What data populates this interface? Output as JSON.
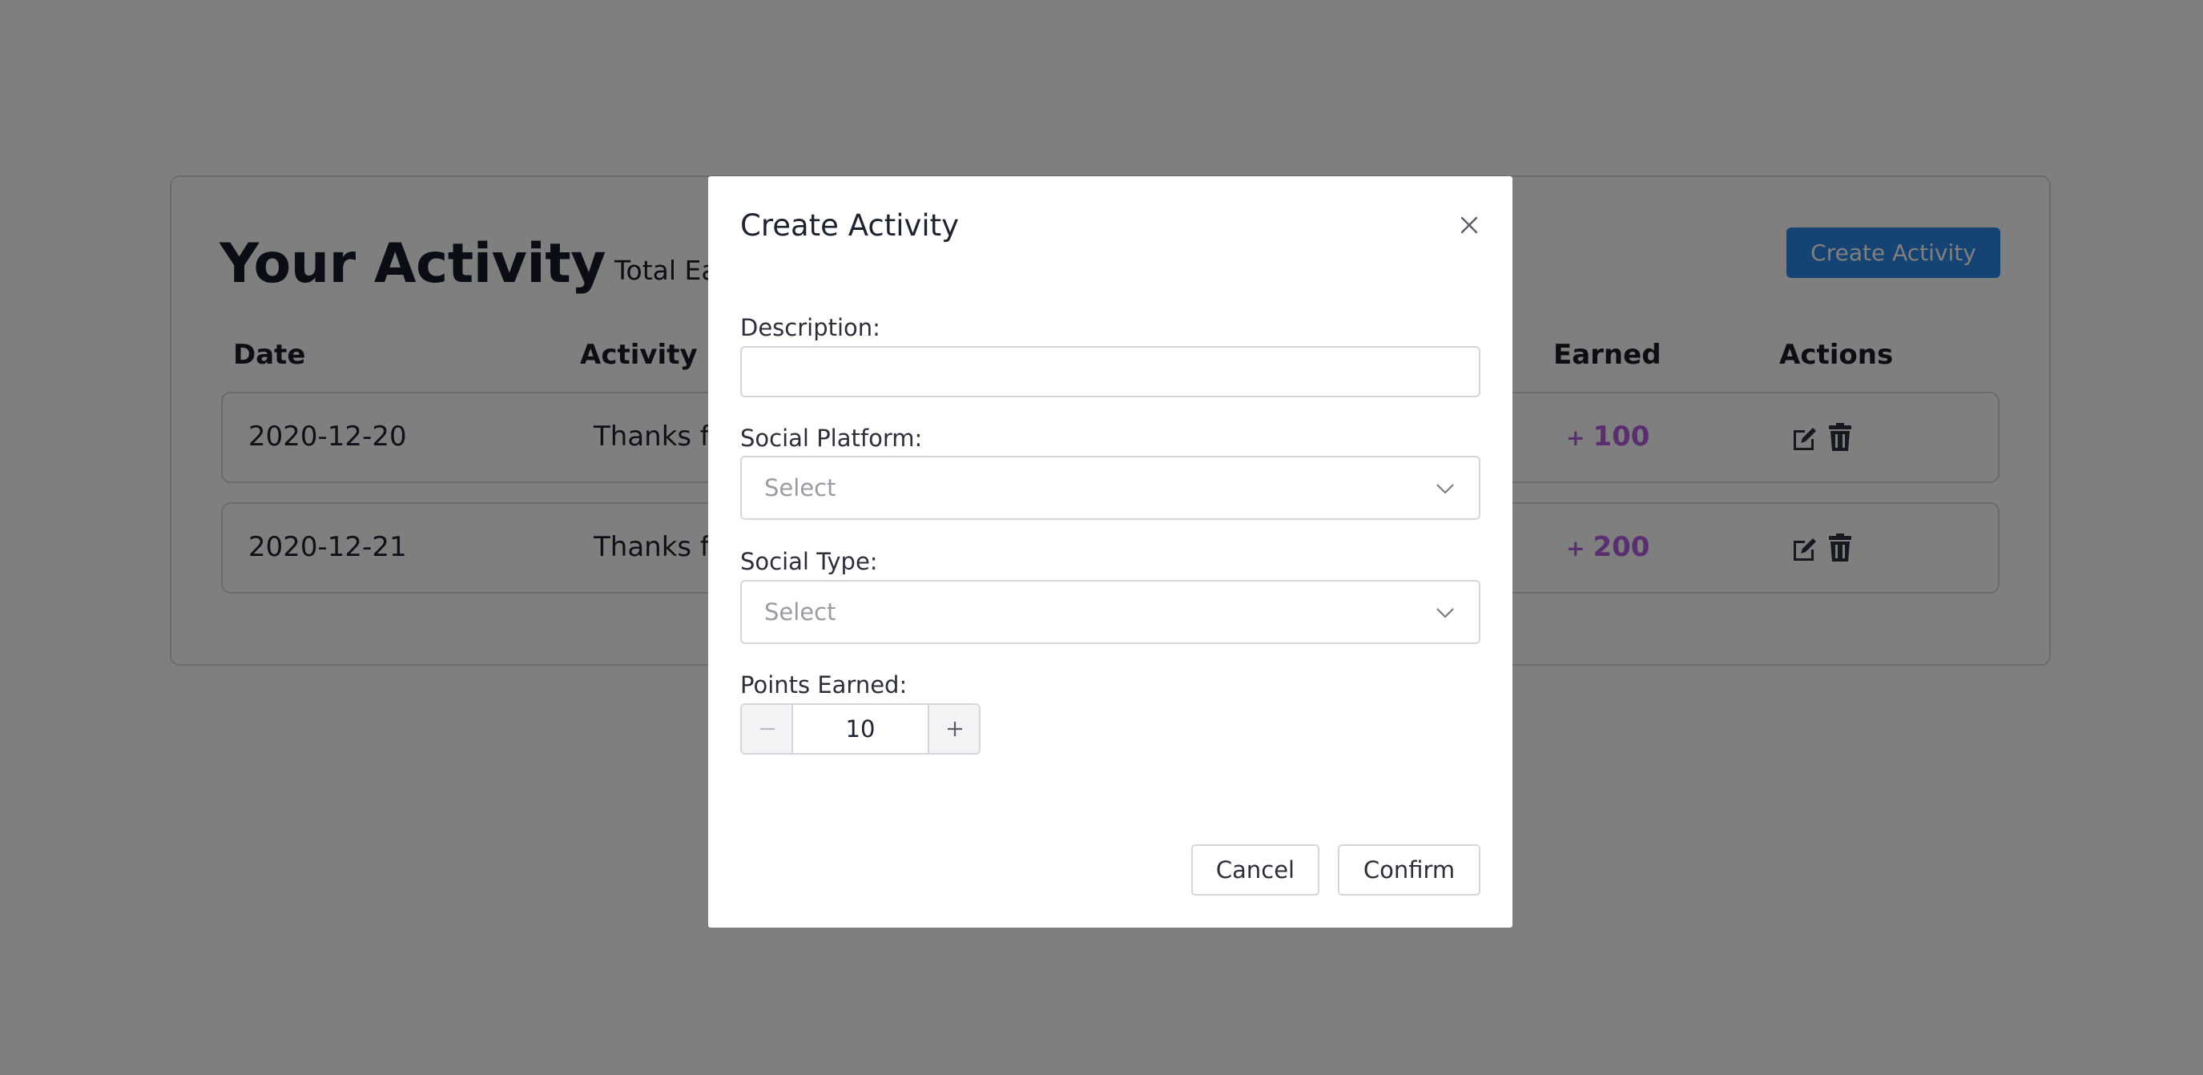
{
  "page": {
    "title": "Your Activity",
    "total_label": "Total Earned",
    "create_button": "Create Activity",
    "columns": [
      "Date",
      "Activity",
      "Earned",
      "Actions"
    ],
    "rows": [
      {
        "date": "2020-12-20",
        "activity": "Thanks fo",
        "earned_sign": "+",
        "earned": "100"
      },
      {
        "date": "2020-12-21",
        "activity": "Thanks fo",
        "earned_sign": "+",
        "earned": "200"
      }
    ],
    "action_icons": [
      "edit-icon",
      "trash-icon"
    ]
  },
  "modal": {
    "title": "Create Activity",
    "close_icon": "close-icon",
    "description": {
      "label": "Description:",
      "value": "",
      "placeholder": ""
    },
    "platform": {
      "label": "Social Platform:",
      "value": "Select",
      "icon": "chevron-down-icon"
    },
    "type": {
      "label": "Social Type:",
      "value": "Select",
      "icon": "chevron-down-icon"
    },
    "points": {
      "label": "Points Earned:",
      "value": "10",
      "minus_icon": "minus-icon",
      "plus_icon": "plus-icon"
    },
    "cancel": "Cancel",
    "confirm": "Confirm"
  },
  "colors": {
    "overlay": "rgba(0,0,0,0.5)",
    "primary": "#2b87e6",
    "earned": "#b25ee0"
  }
}
